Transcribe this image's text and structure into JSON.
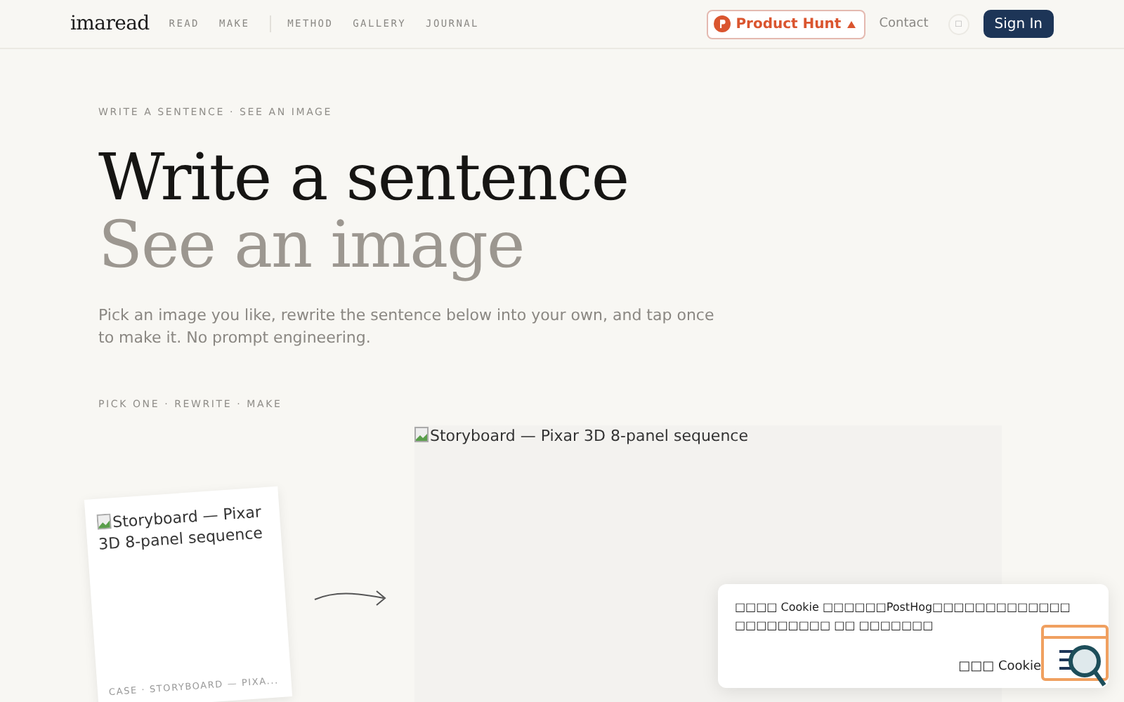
{
  "nav": {
    "logo": "imaread",
    "primary_links": [
      "READ",
      "MAKE"
    ],
    "secondary_links": [
      "METHOD",
      "GALLERY",
      "JOURNAL"
    ],
    "badge": "Product Hunt",
    "contact": "Contact",
    "theme_toggle": "□",
    "sign_in": "Sign In"
  },
  "hero": {
    "eyebrow": "WRITE A SENTENCE · SEE AN IMAGE",
    "title_line_1": "Write a sentence",
    "title_line_2": "See an image",
    "lead": "Pick an image you like, rewrite the sentence below into your own, and tap once to make it. No prompt engineering.",
    "steps": "PICK ONE · REWRITE · MAKE"
  },
  "card": {
    "image_alt": "Storyboard — Pixar 3D 8-panel sequence",
    "caption": "CASE · STORYBOARD — PIXA..."
  },
  "preview": {
    "image_alt": "Storyboard — Pixar 3D 8-panel sequence"
  },
  "cookie": {
    "message": "□□□□ Cookie □□□□□□PostHog□□□□□□□□□□□□□□□□□□□□□□ □□ □□□□□□□",
    "button": "□□□ Cookie"
  }
}
